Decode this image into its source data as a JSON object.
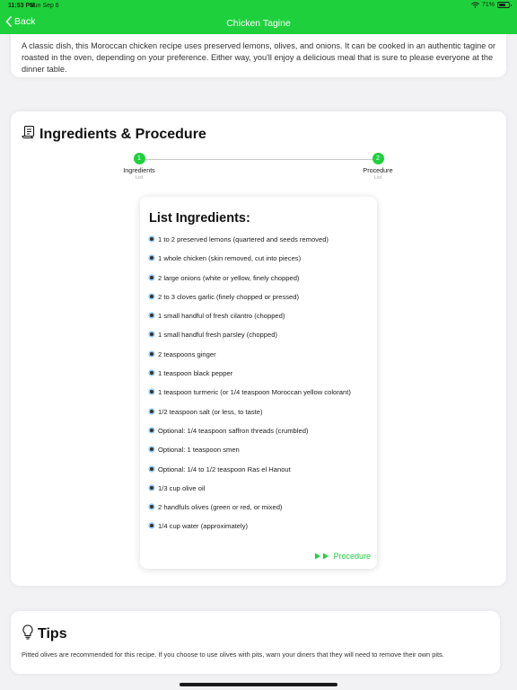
{
  "status_bar": {
    "time": "11:53 PM",
    "date": "Sun Sep 6",
    "battery": "71%",
    "battery_level": 0.71
  },
  "nav": {
    "back_label": "Back",
    "title": "Chicken Tagine"
  },
  "description": {
    "text": "A classic dish, this Moroccan chicken recipe uses preserved lemons, olives, and onions. It can be cooked in an authentic tagine or roasted in the oven, depending on your preference. Either way, you'll enjoy a delicious meal that is sure to please everyone at the dinner table."
  },
  "ingredients_section": {
    "title": "Ingredients & Procedure",
    "steps": [
      {
        "number": "1",
        "label": "Ingredients",
        "sublabel": "List"
      },
      {
        "number": "2",
        "label": "Procedure",
        "sublabel": "List"
      }
    ],
    "list_title": "List Ingredients:",
    "items": [
      "1 to 2 preserved lemons (quartered and seeds removed)",
      "1 whole chicken (skin removed, cut into pieces)",
      "2 large onions (white or yellow, finely chopped)",
      "2 to 3 cloves garlic (finely chopped or pressed)",
      "1 small handful of fresh cilantro (chopped)",
      "1 small handful fresh parsley (chopped)",
      "2 teaspoons ginger",
      "1 teaspoon black pepper",
      "1 teaspoon turmeric (or 1/4 teaspoon Moroccan yellow colorant)",
      "1/2 teaspoon salt (or less, to taste)",
      "Optional: 1/4 teaspoon saffron threads (crumbled)",
      "Optional: 1 teaspoon smen",
      "Optional: 1/4 to 1/2 teaspoon Ras el Hanout",
      "1/3 cup olive oil",
      "2 handfuls olives (green or red, or mixed)",
      "1/4 cup water (approximately)"
    ],
    "next_label": "Procedure"
  },
  "tips": {
    "title": "Tips",
    "text": "Pitted olives are recommended for this recipe. If you choose to use olives with pits, warn your diners that they will need to remove their own pits."
  },
  "colors": {
    "accent": "#1ed13c",
    "background": "#f2f2f4"
  }
}
